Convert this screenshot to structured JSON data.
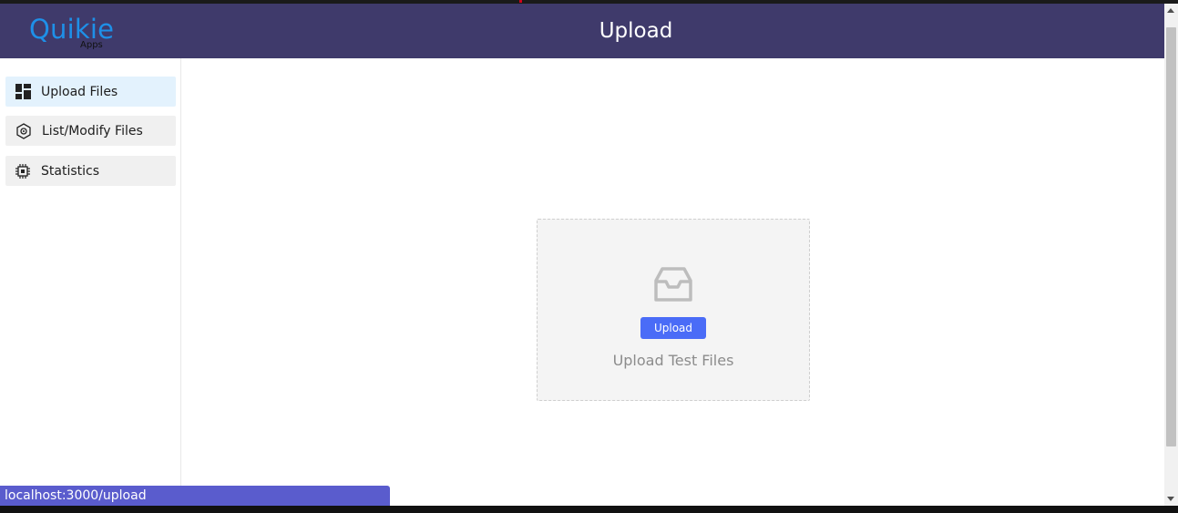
{
  "header": {
    "logo_main": "Quikie",
    "logo_sub": "Apps",
    "title": "Upload"
  },
  "sidebar": {
    "items": [
      {
        "label": "Upload Files",
        "icon": "dashboard-icon",
        "active": true
      },
      {
        "label": "List/Modify Files",
        "icon": "hexagon-gear-icon",
        "active": false
      },
      {
        "label": "Statistics",
        "icon": "chip-icon",
        "active": false
      }
    ]
  },
  "dropzone": {
    "icon": "inbox-icon",
    "button_label": "Upload",
    "text": "Upload Test Files"
  },
  "status": {
    "url": "localhost:3000/upload"
  },
  "colors": {
    "header_bg": "#3f3a6b",
    "logo": "#1e90e8",
    "active_nav": "#e3f2fd",
    "button": "#4a6cf7",
    "status_bar": "#5a5ccd"
  }
}
